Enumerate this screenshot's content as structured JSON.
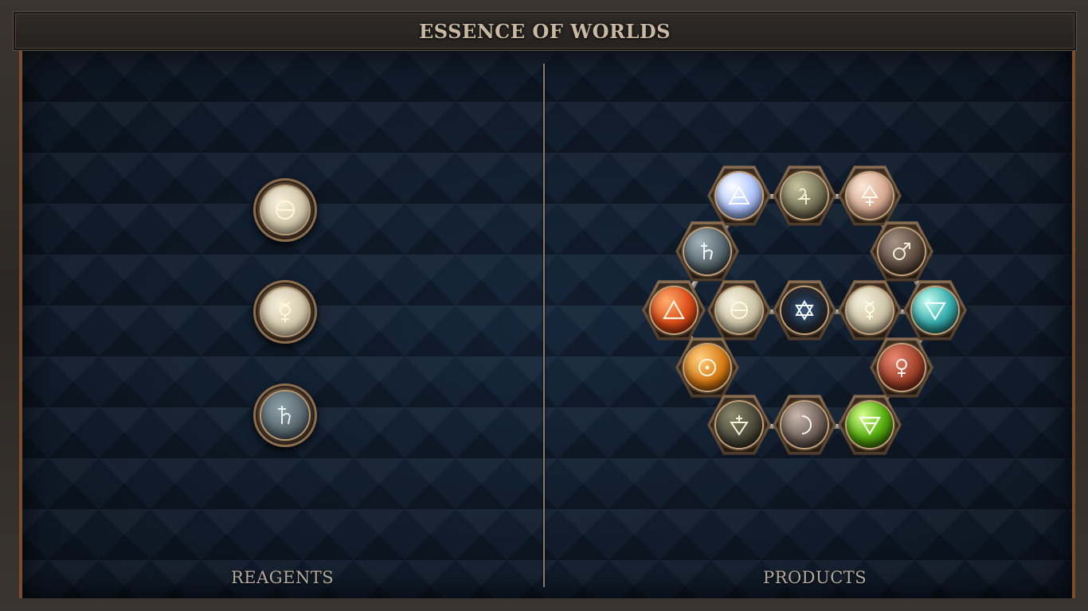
{
  "title": "ESSENCE OF WORLDS",
  "reagents_label": "REAGENTS",
  "products_label": "PRODUCTS",
  "reagents": [
    {
      "name": "Salt",
      "symbol": "salt-icon",
      "color": "#e0d8c0"
    },
    {
      "name": "Mercury",
      "symbol": "mercury-icon",
      "color": "#e2dcc2"
    },
    {
      "name": "Lead",
      "symbol": "lead-icon",
      "color": "#6a7a80"
    }
  ],
  "products": [
    {
      "symbol": "air-icon",
      "color": "#cfe0ff"
    },
    {
      "symbol": "tin-icon",
      "color": "#8a8a6e"
    },
    {
      "symbol": "sulfur-icon",
      "color": "#e3bfa8"
    },
    {
      "symbol": "lead-icon",
      "color": "#6a7a80"
    },
    {
      "symbol": "iron-icon",
      "color": "#7a6658"
    },
    {
      "symbol": "fire-icon",
      "color": "#e4602a"
    },
    {
      "symbol": "salt-icon",
      "color": "#d8d0b8"
    },
    {
      "symbol": "quintessence-icon",
      "color": "#3a4a60"
    },
    {
      "symbol": "mercury-icon",
      "color": "#ddd6bc"
    },
    {
      "symbol": "water-icon",
      "color": "#4ac0c0"
    },
    {
      "symbol": "gold-icon",
      "color": "#d88a20"
    },
    {
      "symbol": "copper-icon",
      "color": "#b04a30"
    },
    {
      "symbol": "vinegar-icon",
      "color": "#5a5848"
    },
    {
      "symbol": "silver-icon",
      "color": "#7a7068"
    },
    {
      "symbol": "earth-icon",
      "color": "#6cc030"
    }
  ]
}
